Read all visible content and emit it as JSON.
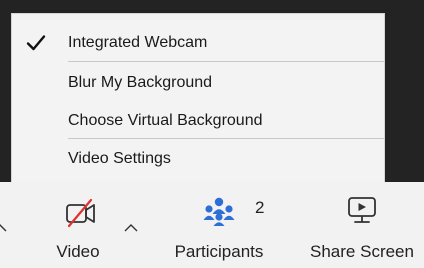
{
  "menu": {
    "items": [
      {
        "label": "Integrated Webcam",
        "checked": true
      },
      {
        "label": "Blur My Background",
        "checked": false
      },
      {
        "label": "Choose Virtual Background",
        "checked": false
      },
      {
        "label": "Video Settings",
        "checked": false
      }
    ]
  },
  "toolbar": {
    "video_label": "Video",
    "participants_label": "Participants",
    "participants_count": "2",
    "share_label": "Share Screen"
  },
  "icons": {
    "check": "check-icon",
    "video_off": "video-off-icon",
    "participants": "participants-icon",
    "share": "share-screen-icon",
    "caret": "chevron-up-icon"
  },
  "colors": {
    "menu_bg": "#f3f3f3",
    "toolbar_bg": "#f2f2f2",
    "video_off_slash": "#e0322d",
    "participants_icon": "#2d6fd6",
    "dark_bg": "#232323"
  }
}
